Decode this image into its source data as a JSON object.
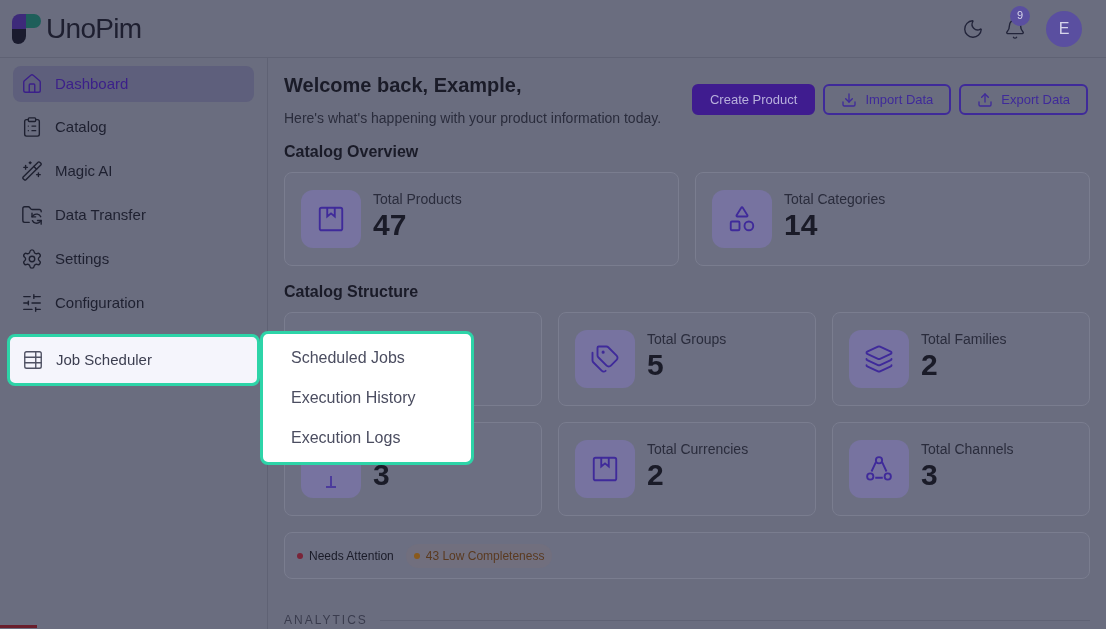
{
  "header": {
    "logo": "UnoPim",
    "notifications": "9",
    "avatar": "E"
  },
  "sidebar": {
    "items": [
      {
        "label": "Dashboard",
        "selected": true,
        "highlighted": false
      },
      {
        "label": "Catalog",
        "selected": false,
        "highlighted": false
      },
      {
        "label": "Magic AI",
        "selected": false,
        "highlighted": false
      },
      {
        "label": "Data Transfer",
        "selected": false,
        "highlighted": false
      },
      {
        "label": "Settings",
        "selected": false,
        "highlighted": false
      },
      {
        "label": "Configuration",
        "selected": false,
        "highlighted": false
      },
      {
        "label": "Job Scheduler",
        "selected": false,
        "highlighted": true
      }
    ]
  },
  "submenu": {
    "items": [
      "Scheduled Jobs",
      "Execution History",
      "Execution Logs"
    ]
  },
  "welcome": {
    "title": "Welcome back, Example,",
    "subtitle": "Here's what's happening with your product information today."
  },
  "actions": [
    {
      "label": "Create Product",
      "kind": "primary"
    },
    {
      "label": "Import Data",
      "kind": "import"
    },
    {
      "label": "Export Data",
      "kind": "export"
    }
  ],
  "catalog_overview": {
    "title": "Catalog Overview",
    "cards": [
      {
        "label": "Total Products",
        "value": "47"
      },
      {
        "label": "Total Categories",
        "value": "14"
      }
    ]
  },
  "catalog_structure": {
    "title": "Catalog Structure",
    "cards": [
      {
        "kind": "stat"
      },
      {
        "kind": "stat",
        "label": "Total Groups",
        "value": "5"
      },
      {
        "kind": "stat",
        "label": "Total Families",
        "value": "2"
      },
      {
        "kind": "stat",
        "value": "3"
      },
      {
        "kind": "stat",
        "label": "Total Currencies",
        "value": "2"
      },
      {
        "kind": "stat",
        "label": "Total Channels",
        "value": "3"
      }
    ]
  },
  "alerts": [
    {
      "label": "Needs Attention",
      "color": "#7a2438",
      "kind": "plain"
    },
    {
      "label": "43 Low Completeness",
      "color": "#8a5a1c",
      "kind": "chip"
    }
  ],
  "analytics": {
    "title": "ANALYTICS"
  }
}
